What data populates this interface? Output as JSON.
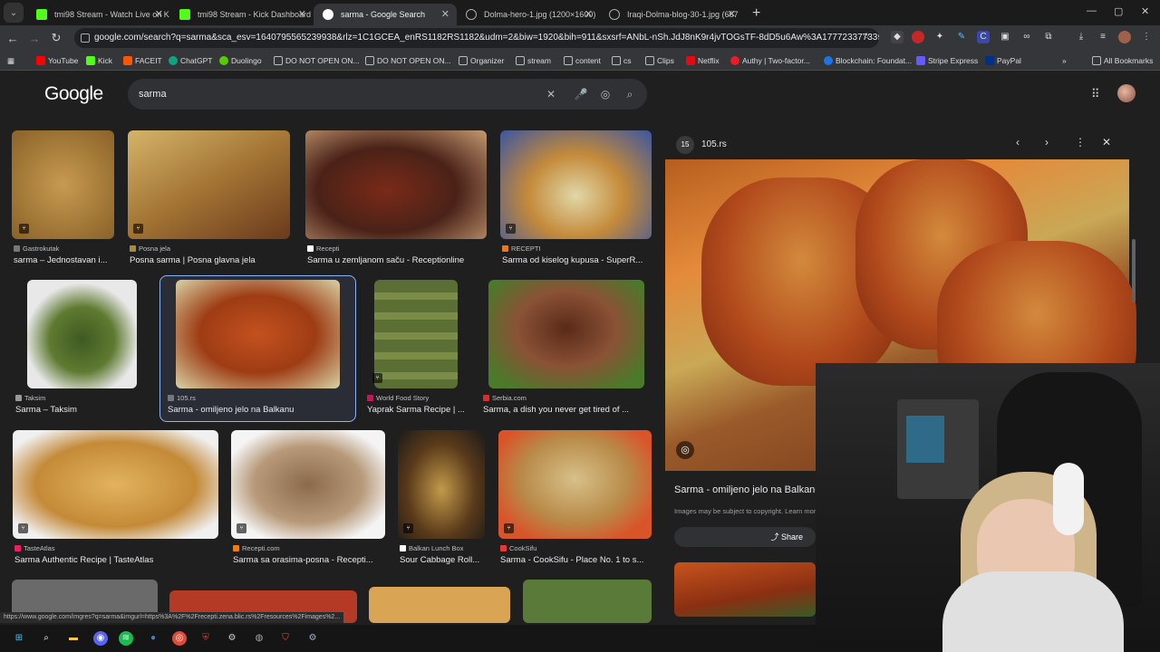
{
  "tabs": [
    {
      "title": "tmi98 Stream - Watch Live on K",
      "fav": "kick"
    },
    {
      "title": "tmi98 Stream - Kick Dashboard",
      "fav": "kick"
    },
    {
      "title": "sarma - Google Search",
      "fav": "google",
      "active": true
    },
    {
      "title": "Dolma-hero-1.jpg (1200×1600)",
      "fav": "globe"
    },
    {
      "title": "Iraqi-Dolma-blog-30-1.jpg (667",
      "fav": "globe"
    }
  ],
  "address": {
    "url": "google.com/search?q=sarma&sca_esv=1640795565239938&rlz=1C1GCEA_enRS1182RS1182&udm=2&biw=1920&bih=911&sxsrf=ANbL-nSh.JdJ8nK9r4jvTOGsTF-8dD5u6Aw%3A1777233773392&ei=b..."
  },
  "bookmarks": [
    {
      "label": "YouTube",
      "color": "#ff0000"
    },
    {
      "label": "Kick",
      "color": "#53fc18"
    },
    {
      "label": "FACEIT",
      "color": "#ff5500"
    },
    {
      "label": "ChatGPT",
      "color": "#10a37f"
    },
    {
      "label": "Duolingo",
      "color": "#58cc02"
    },
    {
      "label": "DO NOT OPEN ON...",
      "color": "#888888"
    },
    {
      "label": "DO NOT OPEN ON...",
      "color": "#888888"
    },
    {
      "label": "Organizer",
      "color": "#888888"
    },
    {
      "label": "stream",
      "color": "#888888"
    },
    {
      "label": "content",
      "color": "#888888"
    },
    {
      "label": "cs",
      "color": "#888888"
    },
    {
      "label": "Clips",
      "color": "#888888"
    },
    {
      "label": "Netflix",
      "color": "#e50914"
    },
    {
      "label": "Authy | Two-factor...",
      "color": "#ec1c24"
    },
    {
      "label": "Blockchain: Foundat...",
      "color": "#1a73e8"
    },
    {
      "label": "Stripe Express",
      "color": "#635bff"
    },
    {
      "label": "PayPal",
      "color": "#003087"
    }
  ],
  "all_bookmarks": "All Bookmarks",
  "google": {
    "logo": "Google",
    "query": "sarma"
  },
  "results": [
    {
      "source": "Gastrokutak",
      "title": "sarma – Jednostavan i...",
      "color": "#b0843f"
    },
    {
      "source": "Posna jela",
      "title": "Posna sarma | Posna glavna jela",
      "color": "#b59342"
    },
    {
      "source": "Recepti",
      "title": "Sarma u zemljanom saču - Receptionline",
      "color": "#7a3a22"
    },
    {
      "source": "RECEPTI",
      "title": "Sarma od kiselog kupusa - SuperR...",
      "color": "#d7c89a"
    },
    {
      "source": "Taksim",
      "title": "Sarma – Taksim",
      "color": "#4e6a2b"
    },
    {
      "source": "105.rs",
      "title": "Sarma - omiljeno jelo na Balkanu",
      "color": "#b9471c"
    },
    {
      "source": "World Food Story",
      "title": "Yaprak Sarma Recipe | ...",
      "color": "#5b6e33"
    },
    {
      "source": "Serbia.com",
      "title": "Sarma, a dish you never get tired of ...",
      "color": "#6a3a24"
    },
    {
      "source": "TasteAtlas",
      "title": "Sarma Authentic Recipe | TasteAtlas",
      "color": "#d39c49"
    },
    {
      "source": "Recepti.com",
      "title": "Sarma sa orasima-posna - Recepti...",
      "color": "#8e6a4d"
    },
    {
      "source": "Balkan Lunch Box",
      "title": "Sour Cabbage Roll...",
      "color": "#6a4a24"
    },
    {
      "source": "CookSifu",
      "title": "Sarma - CookSifu - Place No. 1 to s...",
      "color": "#c7a66a"
    }
  ],
  "panel": {
    "source": "105.rs",
    "title": "Sarma - omiljeno jelo na Balkanu",
    "note": "Images may be subject to copyright. Learn more",
    "share": "Share"
  },
  "status_url": "https://www.google.com/imgres?q=sarma&imgurl=https%3A%2F%2Frecepti.zena.blic.rs%2Fresources%2Fimages%2..."
}
